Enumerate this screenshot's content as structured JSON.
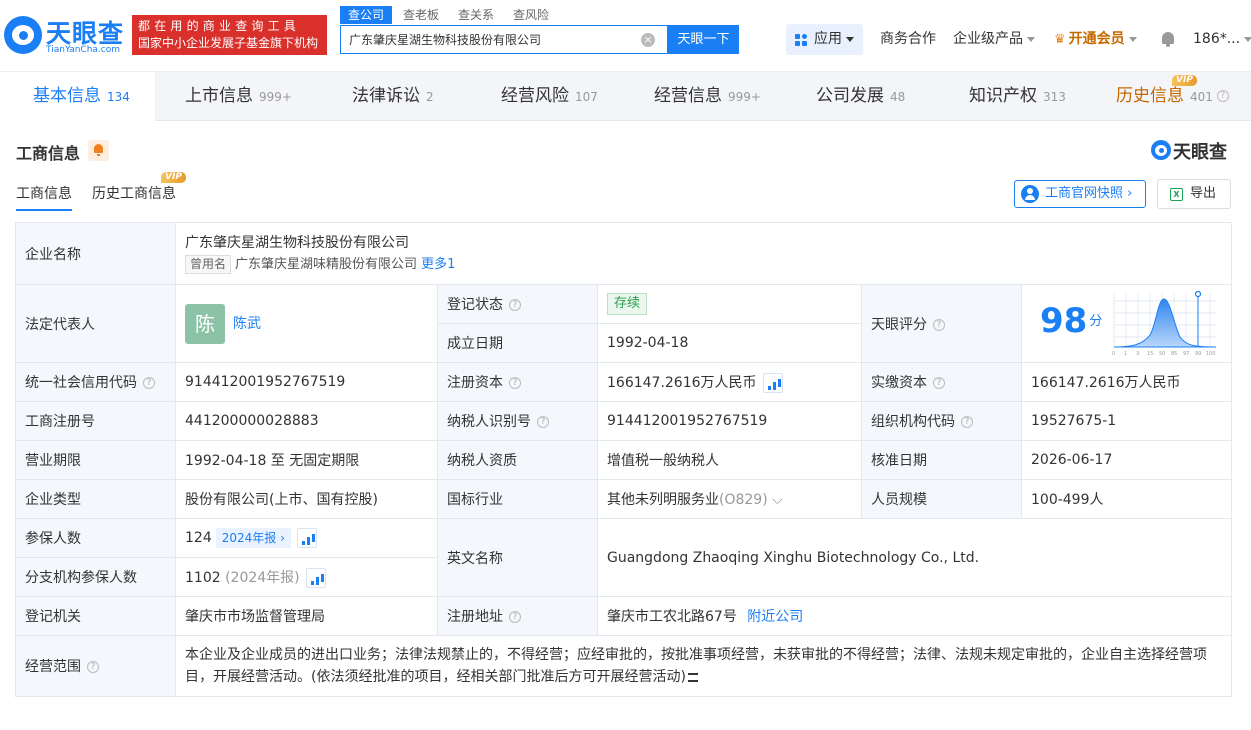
{
  "brand": {
    "name": "天眼查",
    "sub": "TianYanCha.com"
  },
  "slogan": {
    "line1": "都在用的商业查询工具",
    "line2": "国家中小企业发展子基金旗下机构"
  },
  "search": {
    "tabs": [
      "查公司",
      "查老板",
      "查关系",
      "查风险"
    ],
    "value": "广东肇庆星湖生物科技股份有限公司",
    "clear": "×",
    "button": "天眼一下"
  },
  "topnav": {
    "app": "应用",
    "cooperation": "商务合作",
    "enterprise": "企业级产品",
    "vip": "开通会员",
    "user": "186*..."
  },
  "tabs": [
    {
      "label": "基本信息",
      "count": "134"
    },
    {
      "label": "上市信息",
      "count": "999+"
    },
    {
      "label": "法律诉讼",
      "count": "2"
    },
    {
      "label": "经营风险",
      "count": "107"
    },
    {
      "label": "经营信息",
      "count": "999+"
    },
    {
      "label": "公司发展",
      "count": "48"
    },
    {
      "label": "知识产权",
      "count": "313"
    },
    {
      "label": "历史信息",
      "count": "401"
    }
  ],
  "vip": "VIP",
  "section": {
    "title": "工商信息",
    "brand": "天眼查"
  },
  "subtabs": [
    "工商信息",
    "历史工商信息"
  ],
  "actions": {
    "snapshot": "工商官网快照",
    "export": "导出"
  },
  "info": {
    "company_name_label": "企业名称",
    "company_name": "广东肇庆星湖生物科技股份有限公司",
    "used_name_tag": "曾用名",
    "used_name": "广东肇庆星湖味精股份有限公司",
    "more": "更多1",
    "legal_rep_label": "法定代表人",
    "legal_rep_avatar": "陈",
    "legal_rep": "陈武",
    "reg_status_label": "登记状态",
    "reg_status": "存续",
    "found_date_label": "成立日期",
    "found_date": "1992-04-18",
    "score_label": "天眼评分",
    "score": "98",
    "score_unit": "分",
    "credit_code_label": "统一社会信用代码",
    "credit_code": "914412001952767519",
    "reg_capital_label": "注册资本",
    "reg_capital": "166147.2616万人民币",
    "paid_capital_label": "实缴资本",
    "paid_capital": "166147.2616万人民币",
    "reg_no_label": "工商注册号",
    "reg_no": "441200000028883",
    "taxpayer_id_label": "纳税人识别号",
    "taxpayer_id": "914412001952767519",
    "org_code_label": "组织机构代码",
    "org_code": "19527675-1",
    "period_label": "营业期限",
    "period": "1992-04-18 至 无固定期限",
    "taxpayer_q_label": "纳税人资质",
    "taxpayer_q": "增值税一般纳税人",
    "approve_date_label": "核准日期",
    "approve_date": "2026-06-17",
    "type_label": "企业类型",
    "type": "股份有限公司(上市、国有控股)",
    "industry_label": "国标行业",
    "industry": "其他未列明服务业",
    "industry_code": "(O829)",
    "staff_label": "人员规模",
    "staff": "100-499人",
    "insured_label": "参保人数",
    "insured": "124",
    "insured_year": "2024年报",
    "english_label": "英文名称",
    "english": "Guangdong Zhaoqing Xinghu Biotechnology Co., Ltd.",
    "branch_insured_label": "分支机构参保人数",
    "branch_insured": "1102",
    "branch_year": "(2024年报)",
    "authority_label": "登记机关",
    "authority": "肇庆市市场监督管理局",
    "address_label": "注册地址",
    "address": "肇庆市工农北路67号",
    "nearby": "附近公司",
    "scope_label": "经营范围",
    "scope": "本企业及企业成员的进出口业务；法律法规禁止的，不得经营；应经审批的，按批准事项经营，未获审批的不得经营；法律、法规未规定审批的，企业自主选择经营项目，开展经营活动。(依法须经批准的项目，经相关部门批准后方可开展经营活动)"
  },
  "score_chart": {
    "ticks": [
      "0",
      "1",
      "3",
      "15",
      "50",
      "85",
      "97",
      "99",
      "100"
    ],
    "marker": "98"
  },
  "colors": {
    "accent": "#1a7ff5",
    "red": "#d9302c",
    "vip": "#c46900",
    "green": "#2a9f4e"
  }
}
